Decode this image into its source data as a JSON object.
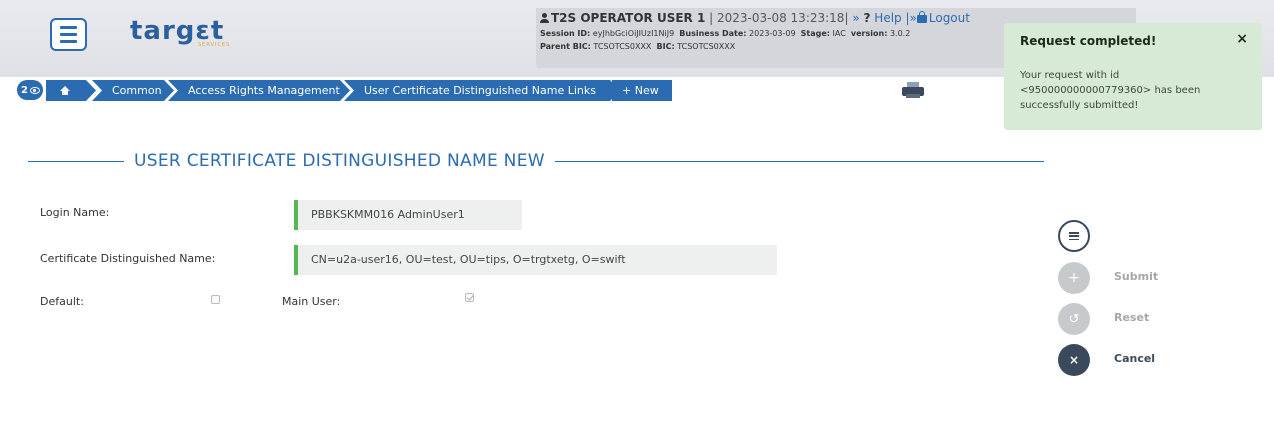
{
  "header": {
    "logo_text": "targɛt",
    "logo_sub": "SERVICES",
    "session": {
      "user": "T2S OPERATOR USER 1",
      "datetime": "| 2023-03-08 13:23:18|",
      "help_prefix": "»",
      "help": "Help",
      "logout_prefix": "|»",
      "logout": "Logout",
      "session_id_label": "Session ID:",
      "session_id": "eyJhbGciOiJIUzI1NiJ9",
      "business_date_label": "Business Date:",
      "business_date": "2023-03-09",
      "stage_label": "Stage:",
      "stage": "IAC",
      "version_label": "version:",
      "version": "3.0.2",
      "parent_bic_label": "Parent BIC:",
      "parent_bic": "TCSOTCS0XXX",
      "bic_label": "BIC:",
      "bic": "TCSOTCS0XXX"
    }
  },
  "breadcrumb": {
    "count": "2",
    "items": [
      "Common",
      "Access Rights Management",
      "User Certificate Distinguished Name Links"
    ],
    "new_label": "+ New"
  },
  "toast": {
    "title": "Request completed!",
    "close": "×",
    "message": "Your request with id <950000000000779360> has been successfully submitted!"
  },
  "page_title": "USER CERTIFICATE DISTINGUISHED NAME NEW",
  "form": {
    "login_name_label": "Login Name:",
    "login_name_value": "PBBKSKMM016 AdminUser1",
    "cert_dn_label": "Certificate Distinguished Name:",
    "cert_dn_value": "CN=u2a-user16, OU=test, OU=tips, O=trgtxetg, O=swift",
    "default_label": "Default:",
    "main_user_label": "Main User:"
  },
  "actions": {
    "submit": "Submit",
    "reset": "Reset",
    "cancel": "Cancel"
  }
}
